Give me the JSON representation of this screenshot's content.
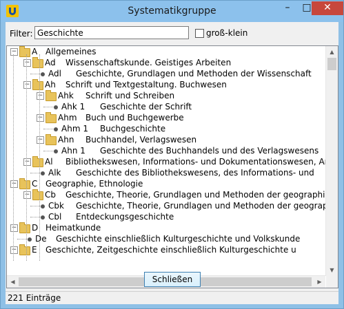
{
  "window": {
    "title": "Systematikgruppe",
    "minimize": "–",
    "maximize": "□",
    "close": "✕"
  },
  "filter": {
    "label": "Filter:",
    "value": "Geschichte",
    "case_label": "groß-klein",
    "case_checked": false
  },
  "tree": [
    {
      "code": "A",
      "text": "Allgemeines"
    },
    {
      "code": "Ad",
      "text": "Wissenschaftskunde. Geistiges Arbeiten"
    },
    {
      "code": "Adl",
      "text": "Geschichte, Grundlagen und Methoden der Wissenschaft"
    },
    {
      "code": "Ah",
      "text": "Schrift und Textgestaltung. Buchwesen"
    },
    {
      "code": "Ahk",
      "text": "Schrift und Schreiben"
    },
    {
      "code": "Ahk 1",
      "text": "Geschichte der Schrift"
    },
    {
      "code": "Ahm",
      "text": "Buch und Buchgewerbe"
    },
    {
      "code": "Ahm 1",
      "text": "Buchgeschichte"
    },
    {
      "code": "Ahn",
      "text": "Buchhandel, Verlagswesen"
    },
    {
      "code": "Ahn 1",
      "text": "Geschichte des Buchhandels und des Verlagswesens"
    },
    {
      "code": "Al",
      "text": "Bibliothekswesen, Informations- und Dokumentationswesen, Arc"
    },
    {
      "code": "Alk",
      "text": "Geschichte des Bibliothekswesens, des Informations- und"
    },
    {
      "code": "C",
      "text": "Geographie, Ethnologie"
    },
    {
      "code": "Cb",
      "text": "Geschichte, Theorie, Grundlagen und Methoden der geographisc"
    },
    {
      "code": "Cbk",
      "text": "Geschichte, Theorie, Grundlagen und Methoden der geographisc"
    },
    {
      "code": "Cbl",
      "text": "Entdeckungsgeschichte"
    },
    {
      "code": "D",
      "text": "Heimatkunde"
    },
    {
      "code": "De",
      "text": "Geschichte einschließlich Kulturgeschichte und Volkskunde"
    },
    {
      "code": "E",
      "text": "Geschichte, Zeitgeschichte einschließlich Kulturgeschichte u"
    }
  ],
  "buttons": {
    "close_label": "Schließen"
  },
  "status": {
    "count_text": "221  Einträge"
  },
  "icons": {
    "expanded": "minus-box-icon",
    "folder": "folder-icon",
    "leaf": "bullet-icon"
  },
  "colors": {
    "titlebar": "#8cc1ec",
    "close_button": "#c7473c",
    "folder": "#e8c35b"
  }
}
